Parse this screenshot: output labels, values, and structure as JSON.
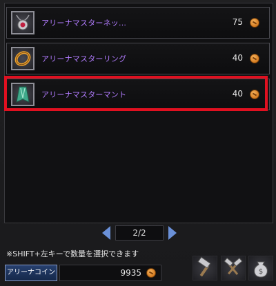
{
  "items": [
    {
      "name": "アリーナマスターネッ...",
      "price": "75",
      "icon": "necklace-icon"
    },
    {
      "name": "アリーナマスターリング",
      "price": "40",
      "icon": "ring-icon"
    },
    {
      "name": "アリーナマスターマント",
      "price": "40",
      "icon": "cloak-icon",
      "highlighted": true
    }
  ],
  "pager": {
    "label": "2/2"
  },
  "hint": "※SHIFT+左キーで数量を選択できます",
  "currency": {
    "button_label": "アリーナコイン",
    "balance": "9935"
  },
  "tools": [
    "hammer-icon",
    "crossed-hammers-icon",
    "money-bag-icon"
  ],
  "colors": {
    "item_name": "#b27cff",
    "highlight": "#e01020",
    "arrow": "#6a90d8"
  }
}
